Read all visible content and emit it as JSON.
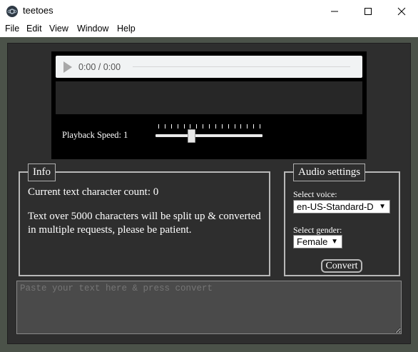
{
  "window": {
    "title": "teetoes",
    "icons": [
      "app-logo-icon",
      "minimize-icon",
      "maximize-icon",
      "close-icon"
    ]
  },
  "menu": {
    "items": [
      "File",
      "Edit",
      "View",
      "Window",
      "Help"
    ]
  },
  "player": {
    "time": "0:00 / 0:00",
    "icons": [
      "play-icon"
    ],
    "playback_speed_label": "Playback Speed: 1",
    "slider_fraction": 0.33,
    "progress_fraction": 0
  },
  "info": {
    "legend": "Info",
    "char_count_text": "Current text character count: 0",
    "note": "Text over 5000 characters will be split up & converted in multiple requests, please be patient."
  },
  "audio_settings": {
    "legend": "Audio settings",
    "voice_label": "Select voice:",
    "voice_value": "en-US-Standard-D",
    "gender_label": "Select gender:",
    "gender_value": "Female",
    "convert_label": "Convert"
  },
  "input": {
    "placeholder": "Paste your text here & press convert"
  },
  "colors": {
    "background": "#4b5249",
    "panel": "#2e2e2e",
    "text": "#ffffff"
  }
}
